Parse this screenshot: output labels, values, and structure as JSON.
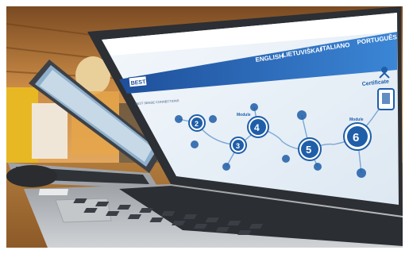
{
  "photo": {
    "subject": "laptops-on-table",
    "screen": {
      "nav_items": [
        "ENGLISH",
        "LIETUVIŠKAI",
        "ITALIANO",
        "PORTUGUÊS"
      ],
      "logo_text": "BEST",
      "side_label": "BEST SENSE CONNECTIONS",
      "flow_steps": [
        "2",
        "3",
        "4",
        "5",
        "6"
      ],
      "module_label": "Module",
      "certificate_label": "Certificate"
    },
    "colors": {
      "wood": "#c98a45",
      "screen_bg": "#eef4fa",
      "banner_blue": "#2e6cc0",
      "step_fill": "#1f5ea8",
      "keyboard": "#2b2e33",
      "laptop_silver": "#b9bcbf"
    }
  }
}
